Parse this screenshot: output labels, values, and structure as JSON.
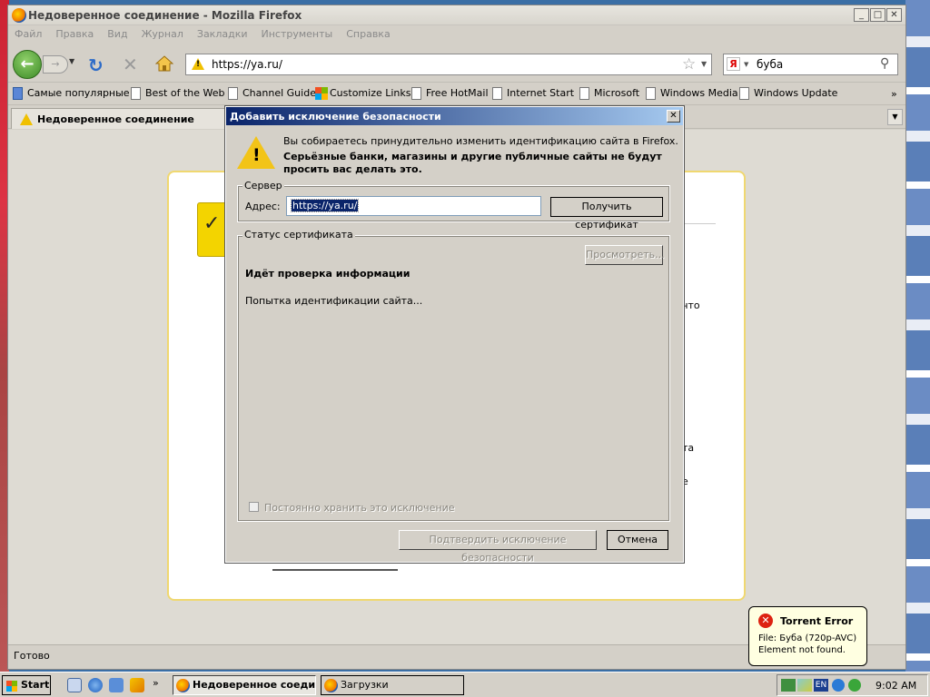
{
  "window": {
    "title": "Недоверенное соединение - Mozilla Firefox"
  },
  "menu": [
    "Файл",
    "Правка",
    "Вид",
    "Журнал",
    "Закладки",
    "Инструменты",
    "Справка"
  ],
  "nav": {
    "url": "https://ya.ru/",
    "search_value": "буба",
    "search_engine_icon": "Я"
  },
  "bookmarks": [
    "Самые популярные",
    "Best of the Web",
    "Channel Guide",
    "Customize Links",
    "Free HotMail",
    "Internet Start",
    "Microsoft",
    "Windows Media",
    "Windows Update"
  ],
  "tab": {
    "label": "Недоверенное соединение"
  },
  "page": {
    "frag1": "что",
    "frag2": "та",
    "frag3": "е"
  },
  "status": {
    "text": "Готово"
  },
  "dialog": {
    "title": "Добавить исключение безопасности",
    "intro": "Вы собираетесь принудительно изменить идентификацию сайта в Firefox.",
    "warning": "Серьёзные банки, магазины и другие публичные сайты не будут просить вас делать это.",
    "server_legend": "Сервер",
    "address_label": "Адрес:",
    "address_value": "https://ya.ru/",
    "get_cert_button": "Получить сертификат",
    "status_legend": "Статус сертификата",
    "view_button": "Просмотреть...",
    "checking": "Идёт проверка информации",
    "attempt": "Попытка идентификации сайта...",
    "permanent_label": "Постоянно хранить это исключение",
    "confirm_button": "Подтвердить исключение безопасности",
    "cancel_button": "Отмена"
  },
  "taskbar": {
    "start": "Start",
    "tasks": [
      "Недоверенное соеди...",
      "Загрузки"
    ],
    "lang": "EN",
    "clock": "9:02 AM"
  },
  "balloon": {
    "title": "Torrent Error",
    "line1": "File: Буба (720p-AVC)",
    "line2": "Element not found."
  }
}
